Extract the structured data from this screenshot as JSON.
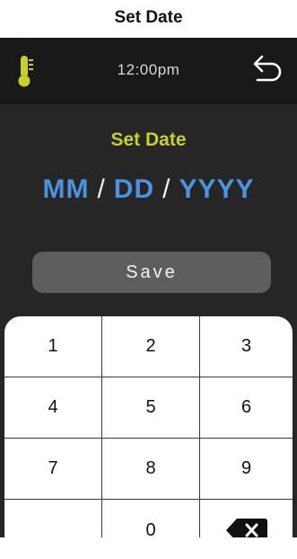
{
  "page_title": "Set Date",
  "header": {
    "time": "12:00pm"
  },
  "icons": {
    "left": "thermometer-icon",
    "right": "back-arrow-icon",
    "backspace": "backspace-icon"
  },
  "main": {
    "heading": "Set Date",
    "date": {
      "month": "MM",
      "day": "DD",
      "year": "YYYY",
      "separator": "/"
    },
    "save_label": "Save"
  },
  "keypad": {
    "keys": [
      "1",
      "2",
      "3",
      "4",
      "5",
      "6",
      "7",
      "8",
      "9",
      "",
      "0"
    ]
  },
  "colors": {
    "accent_yellow": "#c7cf28",
    "date_blue": "#4b93e0",
    "device_bg": "#262626",
    "topbar_bg": "#191919",
    "button_gray": "#5e5e5e"
  }
}
